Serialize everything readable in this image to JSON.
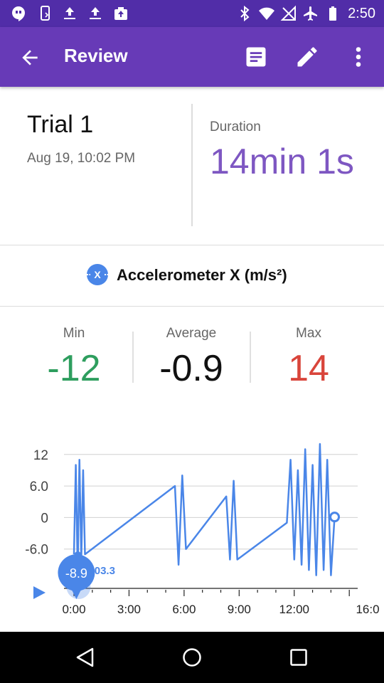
{
  "status_bar": {
    "time": "2:50",
    "left_icons": [
      "hangouts-icon",
      "phone-sync-icon",
      "upload-icon",
      "upload-icon",
      "photos-upload-icon"
    ],
    "right_icons": [
      "bluetooth-icon",
      "wifi-icon",
      "no-signal-icon",
      "airplane-icon",
      "battery-icon"
    ]
  },
  "app_bar": {
    "title": "Review",
    "actions": [
      "notes-icon",
      "edit-icon",
      "more-vert-icon"
    ]
  },
  "trial": {
    "name": "Trial 1",
    "date": "Aug 19, 10:02 PM",
    "duration_label": "Duration",
    "duration_value": "14min 1s"
  },
  "sensor": {
    "icon_letter": "X",
    "label": "Accelerometer X (m/s²)"
  },
  "stats": {
    "min_label": "Min",
    "min_value": "-12",
    "avg_label": "Average",
    "avg_value": "-0.9",
    "max_label": "Max",
    "max_value": "14"
  },
  "colors": {
    "status_bar": "#512da8",
    "app_bar": "#673ab7",
    "duration": "#7e57c2",
    "min": "#2e9e5e",
    "max": "#d9453b",
    "series": "#4a86e8"
  },
  "chart_data": {
    "type": "line",
    "y_tick_labels": [
      "12",
      "6.0",
      "0",
      "-6.0"
    ],
    "y_ticks": [
      12,
      6,
      0,
      -6
    ],
    "x_tick_labels": [
      "0:00",
      "3:00",
      "6:00",
      "9:00",
      "12:00",
      "16:0"
    ],
    "x_ticks_min": [
      0,
      3,
      6,
      9,
      12,
      16
    ],
    "xlim_min": [
      0,
      14.6
    ],
    "ylim": [
      -12,
      14
    ],
    "grid": true,
    "series": [
      {
        "x_min": [
          0,
          0.1,
          0.2,
          0.3,
          0.4,
          0.5,
          0.6,
          5.5,
          5.7,
          5.9,
          6.1,
          8.3,
          8.5,
          8.7,
          8.9,
          11.6,
          11.8,
          12.0,
          12.2,
          12.4,
          12.6,
          12.8,
          13.0,
          13.2,
          13.4,
          13.6,
          13.8,
          14.0,
          14.2
        ],
        "values": [
          -7,
          10,
          -10,
          11,
          -8,
          9,
          -7,
          6,
          -9,
          8,
          -6,
          4,
          -8,
          7,
          -8,
          -1,
          11,
          -8,
          9,
          -9,
          13,
          -10,
          10,
          -11,
          14,
          -10,
          11,
          -11,
          0.1
        ]
      }
    ],
    "cursor": {
      "label": "-8.9",
      "value": -8.9,
      "time_label": "0:03.3",
      "time_sec": 3.3
    },
    "end_marker_value": 0.1
  }
}
